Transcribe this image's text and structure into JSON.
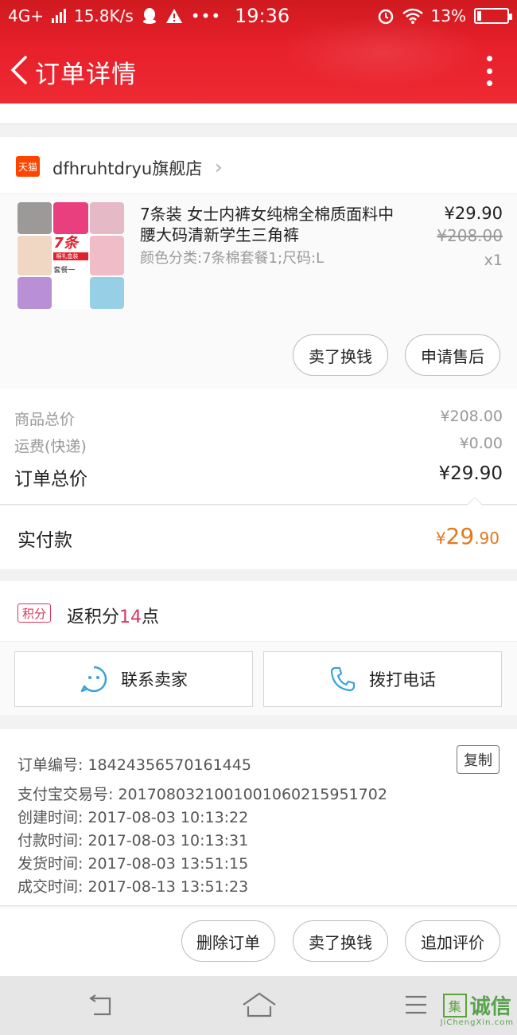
{
  "status_bar": {
    "network": "4G+",
    "speed": "15.8K/s",
    "time": "19:36",
    "battery": "13%",
    "icons": [
      "signal-icon",
      "qq-icon",
      "warning-icon",
      "more-dots-icon",
      "alarm-icon",
      "wifi-icon",
      "battery-icon"
    ]
  },
  "header": {
    "title": "订单详情",
    "back_icon": "chevron-left-icon",
    "menu_icon": "more-vertical-icon"
  },
  "shop": {
    "badge": "天猫",
    "name": "dfhruhtdryu旗舰店"
  },
  "item": {
    "title": "7条装 女士内裤女纯棉全棉质面料中腰大码清新学生三角裤",
    "sku": "颜色分类:7条棉套餐1;尺码:L",
    "price": "¥29.90",
    "original_price": "¥208.00",
    "quantity": "x1",
    "thumb_badge_big": "7条",
    "thumb_badge_small": "棉礼盒装",
    "thumb_badge_text": "套餐一",
    "actions": [
      "卖了换钱",
      "申请售后"
    ]
  },
  "totals": {
    "goods_label": "商品总价",
    "goods_value": "¥208.00",
    "shipping_label": "运费(快递)",
    "shipping_value": "¥0.00",
    "total_label": "订单总价",
    "total_value": "¥29.90"
  },
  "paid": {
    "label": "实付款",
    "currency": "¥",
    "integer": "29",
    "decimal": ".90"
  },
  "points": {
    "tag": "积分",
    "prefix": "返积分",
    "count": "14",
    "suffix": "点"
  },
  "contact": {
    "seller_label": "联系卖家",
    "call_label": "拨打电话"
  },
  "order_info": {
    "order_no": "订单编号: 18424356570161445",
    "copy_label": "复制",
    "alipay_no": "支付宝交易号: 2017080321001001060215951702",
    "created": "创建时间: 2017-08-03 10:13:22",
    "paid": "付款时间: 2017-08-03 10:13:31",
    "shipped": "发货时间: 2017-08-03 13:51:15",
    "completed": "成交时间: 2017-08-13 13:51:23"
  },
  "bottom_actions": [
    "删除订单",
    "卖了换钱",
    "追加评价"
  ],
  "watermark": {
    "box": "集",
    "text": "诚信",
    "sub": "JiChengXin.com"
  },
  "colors": {
    "header_red": "#e7202b",
    "paid_orange": "#e3791c",
    "points_pink": "#d5375e"
  }
}
